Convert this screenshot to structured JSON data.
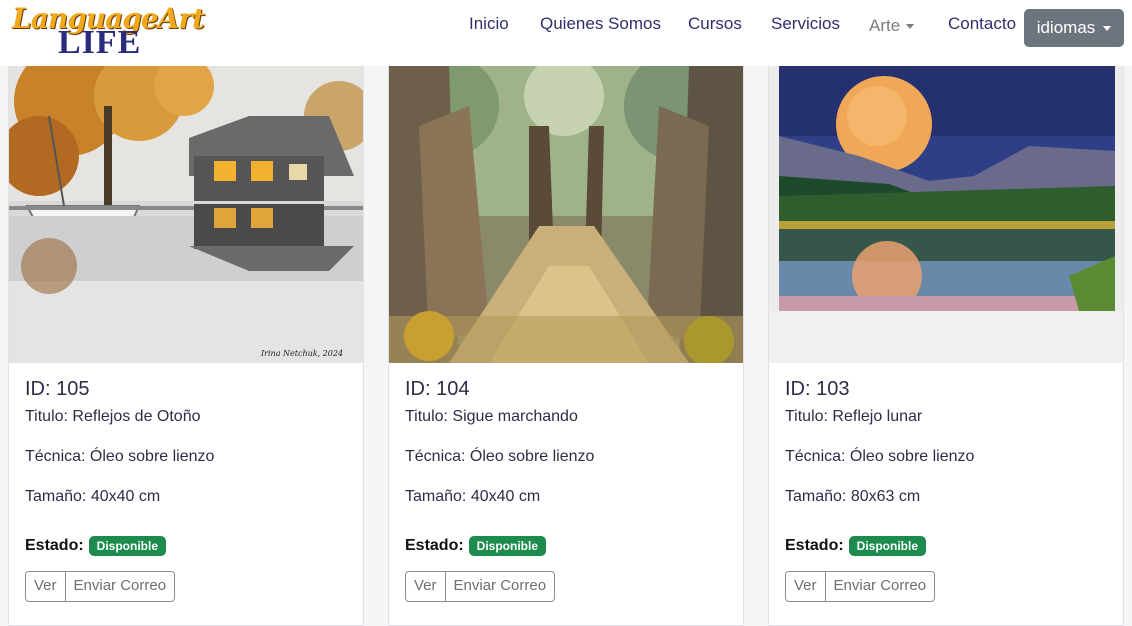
{
  "brand": {
    "line1": "LanguageArt",
    "line2": "LIFE"
  },
  "nav": {
    "inicio": "Inicio",
    "quienes": "Quienes Somos",
    "cursos": "Cursos",
    "servicios": "Servicios",
    "arte": "Arte",
    "contacto": "Contacto",
    "idiomas": "idiomas"
  },
  "cards": [
    {
      "id": "ID: 105",
      "titulo": "Titulo: Reflejos de Otoño",
      "tecnica": "Técnica: Óleo sobre lienzo",
      "tamano": "Tamaño: 40x40 cm",
      "estado_label": "Estado:",
      "estado": "Disponible",
      "ver": "Ver",
      "enviar": "Enviar Correo",
      "signature": "Irina Netchuk, 2024"
    },
    {
      "id": "ID: 104",
      "titulo": "Titulo: Sigue marchando",
      "tecnica": "Técnica: Óleo sobre lienzo",
      "tamano": "Tamaño: 40x40 cm",
      "estado_label": "Estado:",
      "estado": "Disponible",
      "ver": "Ver",
      "enviar": "Enviar Correo"
    },
    {
      "id": "ID: 103",
      "titulo": "Titulo: Reflejo lunar",
      "tecnica": "Técnica: Óleo sobre lienzo",
      "tamano": "Tamaño: 80x63 cm",
      "estado_label": "Estado:",
      "estado": "Disponible",
      "ver": "Ver",
      "enviar": "Enviar Correo"
    }
  ],
  "colors": {
    "nav_text": "#2f2f6e",
    "badge": "#1d8a4e",
    "lang_button": "#6c757d"
  }
}
